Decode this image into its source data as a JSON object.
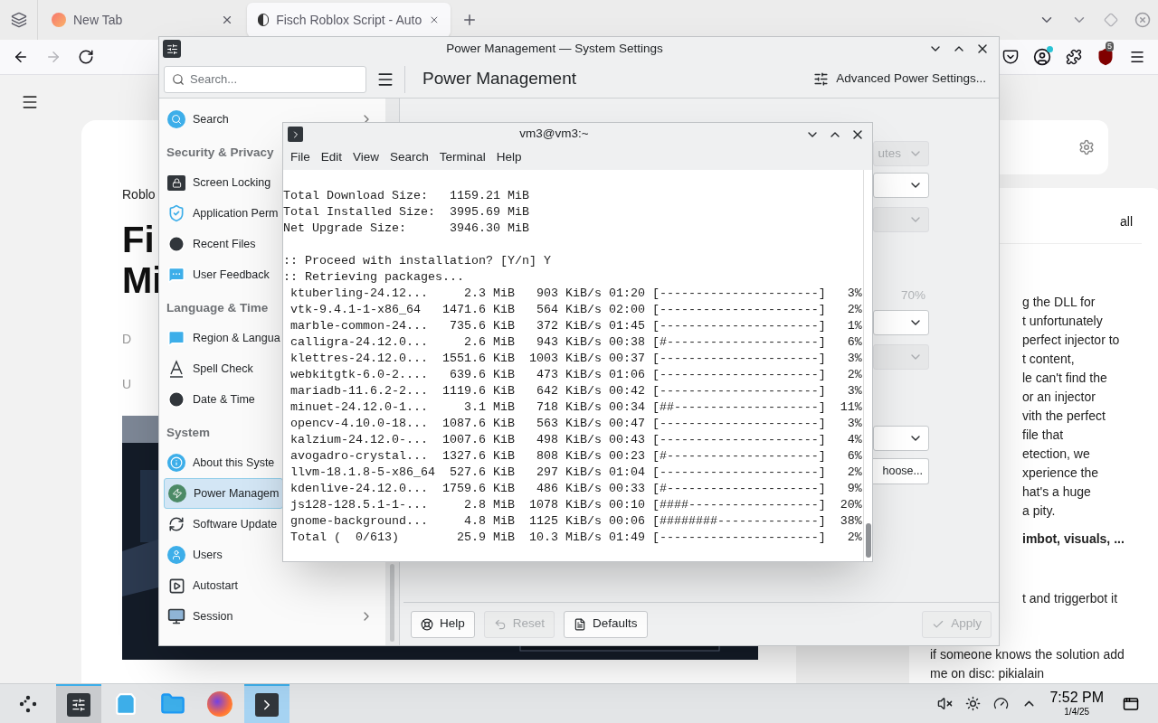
{
  "browser": {
    "tabs": [
      {
        "title": "New Tab",
        "selected": false
      },
      {
        "title": "Fisch Roblox Script - Auto",
        "selected": true
      }
    ],
    "nav_buttons": [
      {
        "kind": "back",
        "disabled": false
      },
      {
        "kind": "forward",
        "disabled": true
      },
      {
        "kind": "reload",
        "disabled": false
      }
    ],
    "extension_badge": "5"
  },
  "page": {
    "breadcrumb": "Roblo",
    "title_lines": [
      "Fi",
      "Mi"
    ],
    "meta_lines": [
      "D",
      "U"
    ],
    "filter_label": "all",
    "article_fragments": [
      "g the DLL for",
      "t unfortunately",
      "perfect injector to",
      "t content,",
      "le can't find the",
      "or an injector",
      "vith the perfect",
      "file that",
      "etection, we",
      "xperience the",
      "hat's a huge",
      "a pity."
    ],
    "bold_fragment": "imbot, visuals, ...",
    "fragment_after": "t and triggerbot it",
    "closing_lines": [
      "if someone knows the solution add",
      "me on disc: pikialain"
    ]
  },
  "settings": {
    "title": "Power Management — System Settings",
    "search_placeholder": "Search...",
    "page_title": "Power Management",
    "advanced_button": "Advanced Power Settings...",
    "sidebar": [
      {
        "kind": "category",
        "label": "Search",
        "selected": false
      },
      {
        "kind": "header",
        "label": "Security & Privacy"
      },
      {
        "kind": "item",
        "label": "Screen Locking",
        "selected": false
      },
      {
        "kind": "item",
        "label": "Application Perm",
        "selected": false
      },
      {
        "kind": "item",
        "label": "Recent Files",
        "selected": false
      },
      {
        "kind": "item",
        "label": "User Feedback",
        "selected": false
      },
      {
        "kind": "header",
        "label": "Language & Time"
      },
      {
        "kind": "item",
        "label": "Region & Langua",
        "selected": false
      },
      {
        "kind": "item",
        "label": "Spell Check",
        "selected": false
      },
      {
        "kind": "item",
        "label": "Date & Time",
        "selected": false
      },
      {
        "kind": "header",
        "label": "System"
      },
      {
        "kind": "item",
        "label": "About this Syste",
        "selected": false
      },
      {
        "kind": "item",
        "label": "Power Managem",
        "selected": true
      },
      {
        "kind": "item",
        "label": "Software Update",
        "selected": false
      },
      {
        "kind": "item",
        "label": "Users",
        "selected": false
      },
      {
        "kind": "item",
        "label": "Autostart",
        "selected": false
      },
      {
        "kind": "category",
        "label": "Session",
        "selected": false
      }
    ],
    "controls": [
      {
        "kind": "dropdown",
        "value": "utes",
        "disabled": true
      },
      {
        "kind": "dropdown",
        "disabled": false
      },
      {
        "kind": "dropdown",
        "disabled": true
      },
      {
        "kind": "reading",
        "value": "70%",
        "disabled": true
      },
      {
        "kind": "dropdown",
        "disabled": false
      },
      {
        "kind": "dropdown",
        "disabled": true
      },
      {
        "kind": "dropdown",
        "disabled": false
      },
      {
        "kind": "button",
        "value": "hoose...",
        "disabled": false
      }
    ],
    "footer": [
      {
        "kind": "help",
        "label": "Help",
        "disabled": false
      },
      {
        "kind": "reset",
        "label": "Reset",
        "disabled": true
      },
      {
        "kind": "defaults",
        "label": "Defaults",
        "disabled": false
      },
      {
        "kind": "apply",
        "label": "Apply",
        "disabled": true
      }
    ]
  },
  "terminal": {
    "title": "vm3@vm3:~",
    "menu": [
      "File",
      "Edit",
      "View",
      "Search",
      "Terminal",
      "Help"
    ],
    "blocks": [
      [
        "Total Download Size:   1159.21 MiB",
        "Total Installed Size:  3995.69 MiB",
        "Net Upgrade Size:      3946.30 MiB"
      ],
      [
        ":: Proceed with installation? [Y/n] Y",
        ":: Retrieving packages...",
        " ktuberling-24.12...     2.3 MiB   903 KiB/s 01:20 [----------------------]   3%",
        " vtk-9.4.1-1-x86_64   1471.6 KiB   564 KiB/s 02:00 [----------------------]   2%",
        " marble-common-24...   735.6 KiB   372 KiB/s 01:45 [----------------------]   1%",
        " calligra-24.12.0...     2.6 MiB   943 KiB/s 00:38 [#---------------------]   6%",
        " klettres-24.12.0...  1551.6 KiB  1003 KiB/s 00:37 [----------------------]   3%",
        " webkitgtk-6.0-2....   639.6 KiB   473 KiB/s 01:06 [----------------------]   2%",
        " mariadb-11.6.2-2...  1119.6 KiB   642 KiB/s 00:42 [----------------------]   3%",
        " minuet-24.12.0-1...     3.1 MiB   718 KiB/s 00:34 [##--------------------]  11%",
        " opencv-4.10.0-18...  1087.6 KiB   563 KiB/s 00:47 [----------------------]   3%",
        " kalzium-24.12.0-...  1007.6 KiB   498 KiB/s 00:43 [----------------------]   4%",
        " avogadro-crystal...  1327.6 KiB   808 KiB/s 00:23 [#---------------------]   6%",
        " llvm-18.1.8-5-x86_64  527.6 KiB   297 KiB/s 01:04 [----------------------]   2%",
        " kdenlive-24.12.0...  1759.6 KiB   486 KiB/s 00:33 [#---------------------]   9%",
        " js128-128.5.1-1-...     2.8 MiB  1078 KiB/s 00:10 [####------------------]  20%",
        " gnome-background...     4.8 MiB  1125 KiB/s 00:06 [########--------------]  38%",
        " Total (  0/613)        25.9 MiB  10.3 MiB/s 01:49 [----------------------]   2%"
      ]
    ]
  },
  "taskbar": {
    "apps": [
      {
        "kind": "settings",
        "open": true,
        "selected": false
      },
      {
        "kind": "discover",
        "open": false,
        "selected": false
      },
      {
        "kind": "files",
        "open": false,
        "selected": false
      },
      {
        "kind": "browser",
        "open": false,
        "selected": false
      },
      {
        "kind": "terminal",
        "open": true,
        "selected": true
      }
    ],
    "time": "7:52 PM",
    "date": "1/4/25"
  }
}
